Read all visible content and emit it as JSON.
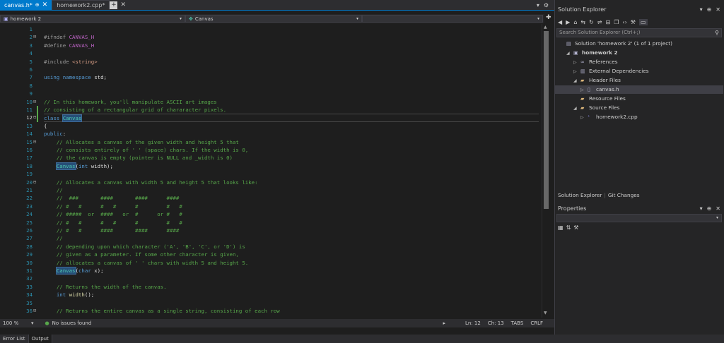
{
  "tabs": [
    {
      "label": "canvas.h*",
      "active": true
    },
    {
      "label": "homework2.cpp*",
      "active": false
    }
  ],
  "nav": {
    "project": "homework 2",
    "scope": "Canvas"
  },
  "colors": {
    "accent": "#007acc",
    "comment": "#57a64a",
    "keyword": "#569cd6",
    "string": "#d69d85",
    "type": "#4ec9b0",
    "macro": "#bd63c5"
  },
  "line_numbers": [
    "1",
    "2",
    "3",
    "4",
    "5",
    "6",
    "7",
    "8",
    "9",
    "10",
    "11",
    "12",
    "13",
    "14",
    "15",
    "16",
    "17",
    "18",
    "19",
    "20",
    "21",
    "22",
    "23",
    "24",
    "25",
    "26",
    "27",
    "28",
    "29",
    "30",
    "31",
    "32",
    "33",
    "34",
    "35",
    "36"
  ],
  "code": [
    [],
    [
      [
        "pp",
        "#ifndef "
      ],
      [
        "mac",
        "CANVAS_H"
      ]
    ],
    [
      [
        "pp",
        "#define "
      ],
      [
        "mac",
        "CANVAS_H"
      ]
    ],
    [],
    [
      [
        "pp",
        "#include "
      ],
      [
        "str",
        "<string>"
      ]
    ],
    [],
    [
      [
        "kw",
        "using namespace "
      ],
      [
        "tx",
        "std;"
      ]
    ],
    [],
    [],
    [
      [
        "cm",
        "// In this homework, you'll manipulate ASCII art images"
      ]
    ],
    [
      [
        "cm",
        "// consisting of a rectangular grid of chararacter pixels."
      ]
    ],
    [
      [
        "kw",
        "class "
      ],
      [
        "tyhl",
        "Canvas"
      ]
    ],
    [
      [
        "tx",
        "{"
      ]
    ],
    [
      [
        "kw",
        "public"
      ],
      [
        "tx",
        ":"
      ]
    ],
    [
      [
        "tx",
        "    "
      ],
      [
        "cm",
        "// Allocates a canvas of the given width and height 5 that"
      ]
    ],
    [
      [
        "tx",
        "    "
      ],
      [
        "cm",
        "// consists entirely of ' ' (space) chars. If the width is 0,"
      ]
    ],
    [
      [
        "tx",
        "    "
      ],
      [
        "cm",
        "// the canvas is empty (pointer is NULL and _width is 0)"
      ]
    ],
    [
      [
        "tx",
        "    "
      ],
      [
        "tyhl",
        "Canvas"
      ],
      [
        "tx",
        "("
      ],
      [
        "kw",
        "int "
      ],
      [
        "tx",
        "width);"
      ]
    ],
    [],
    [
      [
        "tx",
        "    "
      ],
      [
        "cm",
        "// Allocates a canvas with width 5 and height 5 that looks like:"
      ]
    ],
    [
      [
        "tx",
        "    "
      ],
      [
        "cm",
        "//"
      ]
    ],
    [
      [
        "tx",
        "    "
      ],
      [
        "cm",
        "//  ###       ####       ####      ####"
      ]
    ],
    [
      [
        "tx",
        "    "
      ],
      [
        "cm",
        "// #   #      #   #      #         #   #"
      ]
    ],
    [
      [
        "tx",
        "    "
      ],
      [
        "cm",
        "// #####  or  ####   or  #      or #   #"
      ]
    ],
    [
      [
        "tx",
        "    "
      ],
      [
        "cm",
        "// #   #      #   #      #         #   #"
      ]
    ],
    [
      [
        "tx",
        "    "
      ],
      [
        "cm",
        "// #   #      ####       ####      ####"
      ]
    ],
    [
      [
        "tx",
        "    "
      ],
      [
        "cm",
        "//"
      ]
    ],
    [
      [
        "tx",
        "    "
      ],
      [
        "cm",
        "// depending upon which character ('A', 'B', 'C', or 'D') is"
      ]
    ],
    [
      [
        "tx",
        "    "
      ],
      [
        "cm",
        "// given as a parameter. If some other character is given,"
      ]
    ],
    [
      [
        "tx",
        "    "
      ],
      [
        "cm",
        "// allocates a canvas of ' ' chars with width 5 and height 5."
      ]
    ],
    [
      [
        "tx",
        "    "
      ],
      [
        "tyhl",
        "Canvas"
      ],
      [
        "tx",
        "("
      ],
      [
        "kw",
        "char "
      ],
      [
        "tx",
        "x);"
      ]
    ],
    [],
    [
      [
        "tx",
        "    "
      ],
      [
        "cm",
        "// Returns the width of the canvas."
      ]
    ],
    [
      [
        "tx",
        "    "
      ],
      [
        "kw",
        "int "
      ],
      [
        "fn",
        "width"
      ],
      [
        "tx",
        "();"
      ]
    ],
    [],
    [
      [
        "tx",
        "    "
      ],
      [
        "cm",
        "// Returns the entire canvas as a single string, consisting of each row"
      ]
    ]
  ],
  "current_line": 12,
  "status": {
    "zoom": "100 %",
    "issues": "No issues found",
    "line": "Ln: 12",
    "char": "Ch: 13",
    "tabs": "TABS",
    "eol": "CRLF"
  },
  "bottom_tabs": [
    "Error List",
    "Output"
  ],
  "solution_explorer": {
    "title": "Solution Explorer",
    "search_placeholder": "Search Solution Explorer (Ctrl+;)",
    "tree": [
      {
        "label": "Solution 'homework 2' (1 of 1 project)",
        "level": 0,
        "exp": "",
        "icon": "solution-icon",
        "glyph": "▤"
      },
      {
        "label": "homework 2",
        "level": 1,
        "exp": "◢",
        "icon": "project-icon",
        "glyph": "▣",
        "bold": true
      },
      {
        "label": "References",
        "level": 2,
        "exp": "▷",
        "icon": "references-icon",
        "glyph": "∞"
      },
      {
        "label": "External Dependencies",
        "level": 2,
        "exp": "▷",
        "icon": "dependencies-icon",
        "glyph": "▥"
      },
      {
        "label": "Header Files",
        "level": 2,
        "exp": "◢",
        "icon": "folder-icon",
        "glyph": "▰"
      },
      {
        "label": "canvas.h",
        "level": 3,
        "exp": "▷",
        "icon": "header-file-icon",
        "glyph": "▯",
        "selected": true
      },
      {
        "label": "Resource Files",
        "level": 2,
        "exp": "",
        "icon": "folder-icon",
        "glyph": "▰"
      },
      {
        "label": "Source Files",
        "level": 2,
        "exp": "◢",
        "icon": "folder-icon",
        "glyph": "▰"
      },
      {
        "label": "homework2.cpp",
        "level": 3,
        "exp": "▷",
        "icon": "cpp-file-icon",
        "glyph": "⁺"
      }
    ],
    "tabs": [
      "Solution Explorer",
      "Git Changes"
    ]
  },
  "properties": {
    "title": "Properties"
  }
}
